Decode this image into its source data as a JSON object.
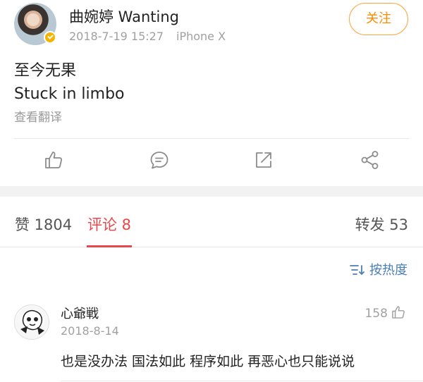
{
  "post": {
    "username": "曲婉婷 Wanting",
    "timestamp": "2018-7-19 15:27",
    "device": "iPhone X",
    "follow_label": "关注",
    "text_line1": "至今无果",
    "text_line2": "Stuck in limbo",
    "translate_label": "查看翻译",
    "accent_color": "#ff8a00",
    "actions": [
      "like-icon",
      "comment-icon",
      "share-icon",
      "forward-icon"
    ]
  },
  "tabs": {
    "likes": "赞 1804",
    "comments": "评论 8",
    "reposts": "转发 53",
    "active_color": "#e8474b"
  },
  "sort": {
    "label": "按热度",
    "icon": "sort-icon"
  },
  "comment": {
    "username": "心爺戦",
    "date": "2018-8-14",
    "likes": "158",
    "text": "也是没办法 国法如此 程序如此 再恶心也只能说说"
  }
}
